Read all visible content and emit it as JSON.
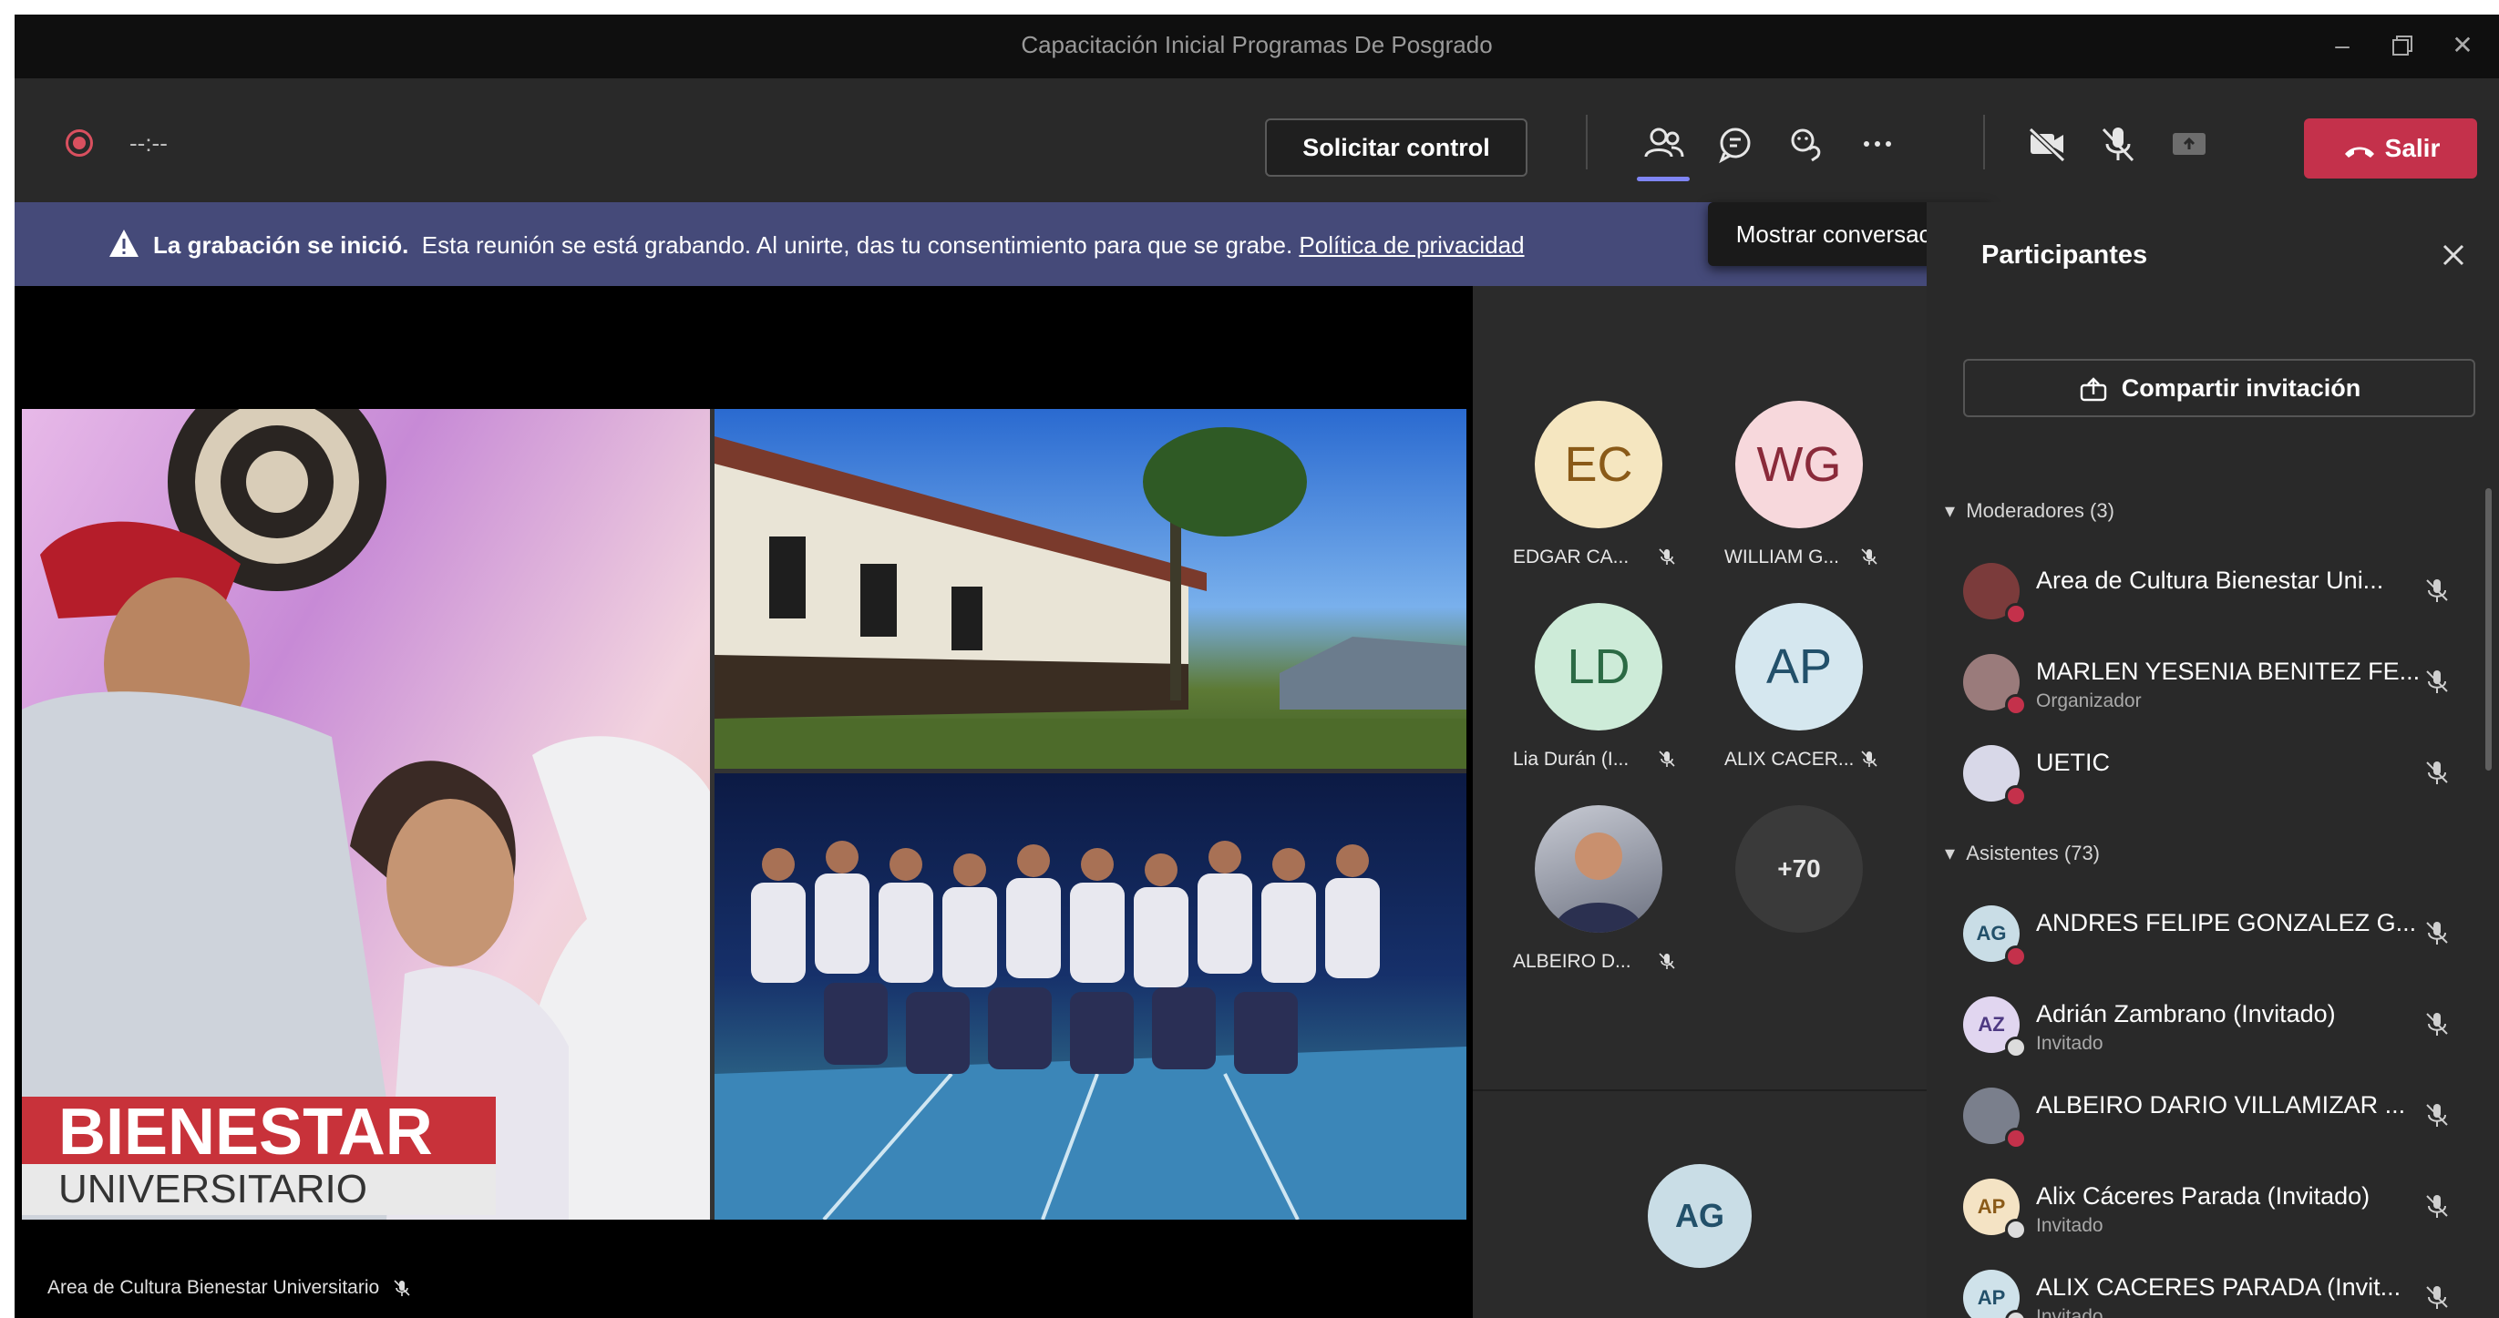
{
  "window": {
    "title": "Capacitación Inicial Programas De Posgrado"
  },
  "toolbar": {
    "timer": "--:--",
    "request_control": "Solicitar control",
    "leave": "Salir"
  },
  "tooltip": "Mostrar conversación",
  "banner": {
    "bold": "La grabación se inició.",
    "text": "Esta reunión se está grabando. Al unirte, das tu consentimiento para que se grabe.",
    "link": "Política de privacidad"
  },
  "stage": {
    "brand_line1": "BIENESTAR",
    "brand_line2": "UNIVERSITARIO",
    "presenter_caption": "Area de Cultura Bienestar Universitario"
  },
  "gallery": {
    "tiles": [
      {
        "initials": "EC",
        "name": "EDGAR CA...",
        "bg": "#f5e6c0",
        "fg": "#8a5a18"
      },
      {
        "initials": "WG",
        "name": "WILLIAM G...",
        "bg": "#f7d8dc",
        "fg": "#8a2a3a"
      },
      {
        "initials": "LD",
        "name": "Lia Durán (I...",
        "bg": "#cdebd8",
        "fg": "#2b6a44"
      },
      {
        "initials": "AP",
        "name": "ALIX CACER...",
        "bg": "#d5e7ef",
        "fg": "#22506a"
      },
      {
        "initials": "",
        "name": "ALBEIRO D...",
        "bg": "#8a8f9a",
        "fg": "#fff"
      }
    ],
    "more": "+70",
    "self_initials": "AG"
  },
  "panel": {
    "title": "Participantes",
    "share": "Compartir invitación",
    "moderators_label": "Moderadores (3)",
    "attendees_label": "Asistentes (73)",
    "moderators": [
      {
        "initials": "",
        "name": "Area de Cultura Bienestar Uni...",
        "sub": "",
        "bg": "#7b3b3b",
        "badge": "#c4314b"
      },
      {
        "initials": "",
        "name": "MARLEN YESENIA BENITEZ FE...",
        "sub": "Organizador",
        "bg": "#9a7b7b",
        "badge": "#c4314b"
      },
      {
        "initials": "",
        "name": "UETIC",
        "sub": "",
        "bg": "#d8d8e8",
        "badge": "#c4314b"
      }
    ],
    "attendees": [
      {
        "initials": "AG",
        "name": "ANDRES FELIPE GONZALEZ G...",
        "sub": "",
        "bg": "#c9dde6",
        "fg": "#22506a",
        "badge": "#c4314b"
      },
      {
        "initials": "AZ",
        "name": "Adrián Zambrano (Invitado)",
        "sub": "Invitado",
        "bg": "#e1d6f0",
        "fg": "#4e3a82",
        "badge": "#dcdcdc"
      },
      {
        "initials": "",
        "name": "ALBEIRO DARIO VILLAMIZAR ...",
        "sub": "",
        "bg": "#7a7f8c",
        "fg": "#fff",
        "badge": "#c4314b"
      },
      {
        "initials": "AP",
        "name": "Alix Cáceres Parada (Invitado)",
        "sub": "Invitado",
        "bg": "#f4e3c4",
        "fg": "#8a5a18",
        "badge": "#dcdcdc"
      },
      {
        "initials": "AP",
        "name": "ALIX CACERES PARADA (Invit...",
        "sub": "Invitado",
        "bg": "#cfe2ea",
        "fg": "#22506a",
        "badge": "#dcdcdc"
      }
    ]
  },
  "colors": {
    "accent": "#7f85f5",
    "leave": "#c4314b",
    "banner": "#454a79"
  }
}
